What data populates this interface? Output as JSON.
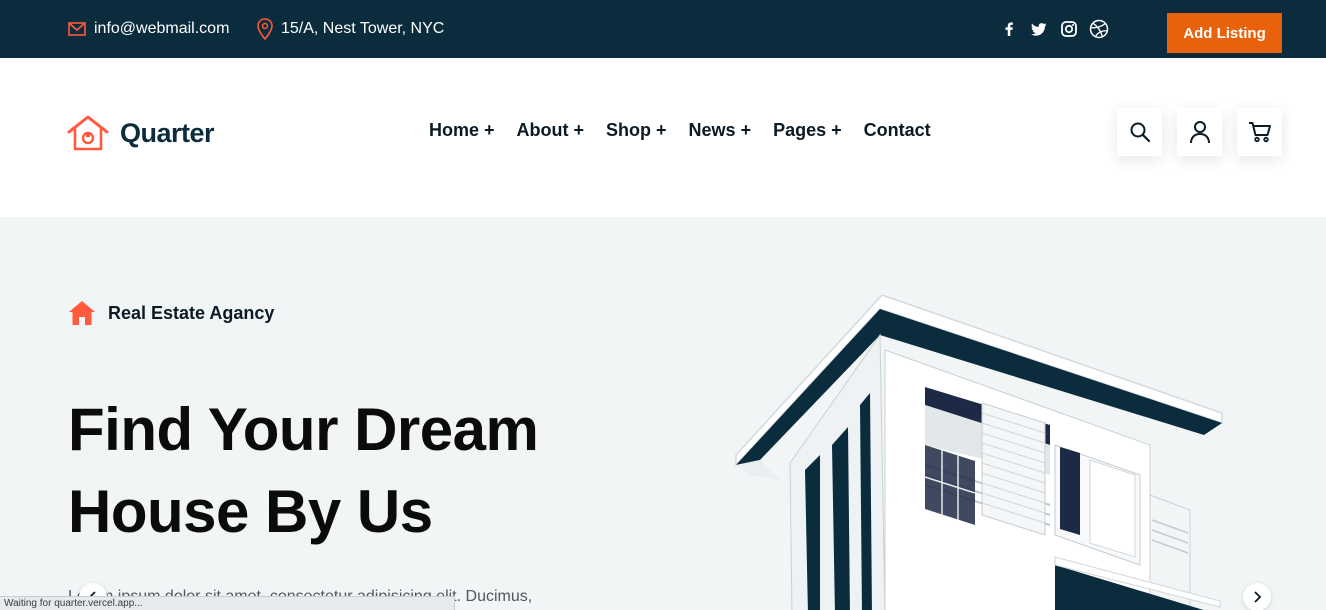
{
  "topbar": {
    "email": "info@webmail.com",
    "address": "15/A, Nest Tower, NYC",
    "social_icons": [
      "facebook-icon",
      "twitter-icon",
      "instagram-icon",
      "dribbble-icon"
    ],
    "cta_label": "Add Listing",
    "bg_color": "#0b2c3d",
    "cta_color": "#e8620e"
  },
  "header": {
    "logo_text": "Quarter",
    "nav": [
      {
        "label": "Home",
        "suffix": "+"
      },
      {
        "label": "About",
        "suffix": "+"
      },
      {
        "label": "Shop",
        "suffix": "+"
      },
      {
        "label": "News",
        "suffix": "+"
      },
      {
        "label": "Pages",
        "suffix": "+"
      },
      {
        "label": "Contact",
        "suffix": ""
      }
    ],
    "actions": [
      "search-icon",
      "user-icon",
      "cart-icon"
    ]
  },
  "hero": {
    "tagline": "Real Estate Agancy",
    "title_line1": "Find Your Dream",
    "title_line2": "House By Us",
    "lead": "Lorem ipsum dolor sit amet, consectetur adipisicing elit. Ducimus,",
    "accent_color": "#ff5a3c"
  },
  "browser": {
    "status": "Waiting for quarter.vercel.app..."
  }
}
